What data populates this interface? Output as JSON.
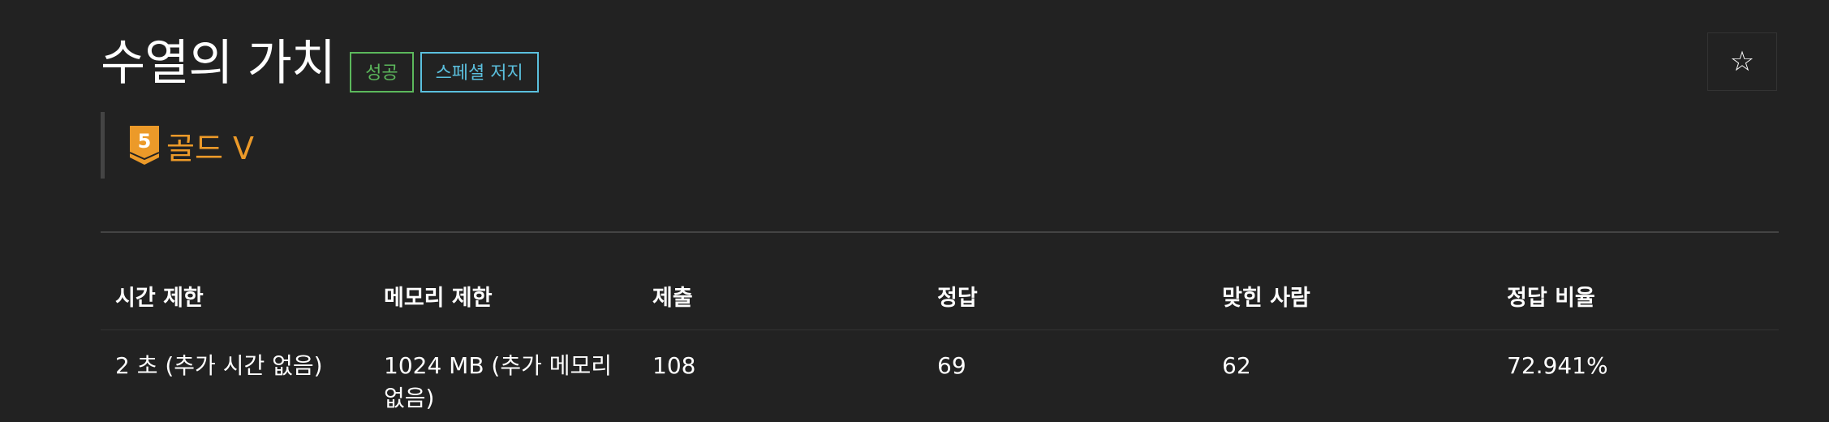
{
  "problem": {
    "title": "수열의 가치",
    "badges": {
      "success": "성공",
      "special_judge": "스페셜 저지"
    },
    "tier": {
      "level": "5",
      "label": "골드 V",
      "color": "#ec9a29"
    },
    "star_icon": "☆"
  },
  "stats": {
    "headers": [
      "시간 제한",
      "메모리 제한",
      "제출",
      "정답",
      "맞힌 사람",
      "정답 비율"
    ],
    "values": [
      "2 초 (추가 시간 없음)",
      "1024 MB (추가 메모리 없음)",
      "108",
      "69",
      "62",
      "72.941%"
    ]
  },
  "colors": {
    "background": "#222222",
    "success": "#5cb85c",
    "info": "#5bc0de",
    "gold": "#ec9a29"
  }
}
